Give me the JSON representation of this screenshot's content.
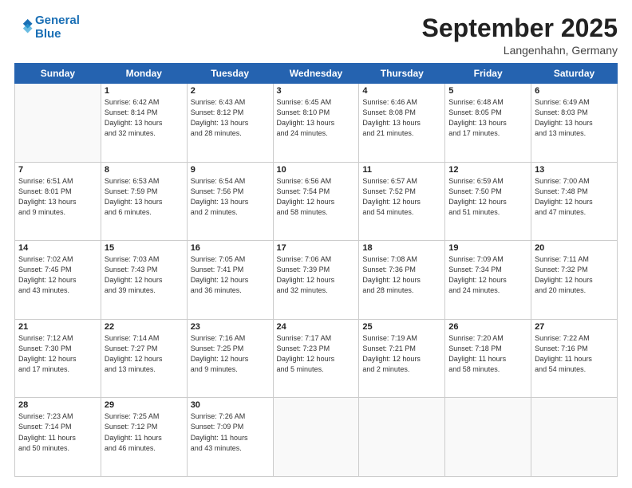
{
  "header": {
    "logo_line1": "General",
    "logo_line2": "Blue",
    "month": "September 2025",
    "location": "Langenhahn, Germany"
  },
  "weekdays": [
    "Sunday",
    "Monday",
    "Tuesday",
    "Wednesday",
    "Thursday",
    "Friday",
    "Saturday"
  ],
  "weeks": [
    [
      {
        "day": "",
        "info": ""
      },
      {
        "day": "1",
        "info": "Sunrise: 6:42 AM\nSunset: 8:14 PM\nDaylight: 13 hours\nand 32 minutes."
      },
      {
        "day": "2",
        "info": "Sunrise: 6:43 AM\nSunset: 8:12 PM\nDaylight: 13 hours\nand 28 minutes."
      },
      {
        "day": "3",
        "info": "Sunrise: 6:45 AM\nSunset: 8:10 PM\nDaylight: 13 hours\nand 24 minutes."
      },
      {
        "day": "4",
        "info": "Sunrise: 6:46 AM\nSunset: 8:08 PM\nDaylight: 13 hours\nand 21 minutes."
      },
      {
        "day": "5",
        "info": "Sunrise: 6:48 AM\nSunset: 8:05 PM\nDaylight: 13 hours\nand 17 minutes."
      },
      {
        "day": "6",
        "info": "Sunrise: 6:49 AM\nSunset: 8:03 PM\nDaylight: 13 hours\nand 13 minutes."
      }
    ],
    [
      {
        "day": "7",
        "info": "Sunrise: 6:51 AM\nSunset: 8:01 PM\nDaylight: 13 hours\nand 9 minutes."
      },
      {
        "day": "8",
        "info": "Sunrise: 6:53 AM\nSunset: 7:59 PM\nDaylight: 13 hours\nand 6 minutes."
      },
      {
        "day": "9",
        "info": "Sunrise: 6:54 AM\nSunset: 7:56 PM\nDaylight: 13 hours\nand 2 minutes."
      },
      {
        "day": "10",
        "info": "Sunrise: 6:56 AM\nSunset: 7:54 PM\nDaylight: 12 hours\nand 58 minutes."
      },
      {
        "day": "11",
        "info": "Sunrise: 6:57 AM\nSunset: 7:52 PM\nDaylight: 12 hours\nand 54 minutes."
      },
      {
        "day": "12",
        "info": "Sunrise: 6:59 AM\nSunset: 7:50 PM\nDaylight: 12 hours\nand 51 minutes."
      },
      {
        "day": "13",
        "info": "Sunrise: 7:00 AM\nSunset: 7:48 PM\nDaylight: 12 hours\nand 47 minutes."
      }
    ],
    [
      {
        "day": "14",
        "info": "Sunrise: 7:02 AM\nSunset: 7:45 PM\nDaylight: 12 hours\nand 43 minutes."
      },
      {
        "day": "15",
        "info": "Sunrise: 7:03 AM\nSunset: 7:43 PM\nDaylight: 12 hours\nand 39 minutes."
      },
      {
        "day": "16",
        "info": "Sunrise: 7:05 AM\nSunset: 7:41 PM\nDaylight: 12 hours\nand 36 minutes."
      },
      {
        "day": "17",
        "info": "Sunrise: 7:06 AM\nSunset: 7:39 PM\nDaylight: 12 hours\nand 32 minutes."
      },
      {
        "day": "18",
        "info": "Sunrise: 7:08 AM\nSunset: 7:36 PM\nDaylight: 12 hours\nand 28 minutes."
      },
      {
        "day": "19",
        "info": "Sunrise: 7:09 AM\nSunset: 7:34 PM\nDaylight: 12 hours\nand 24 minutes."
      },
      {
        "day": "20",
        "info": "Sunrise: 7:11 AM\nSunset: 7:32 PM\nDaylight: 12 hours\nand 20 minutes."
      }
    ],
    [
      {
        "day": "21",
        "info": "Sunrise: 7:12 AM\nSunset: 7:30 PM\nDaylight: 12 hours\nand 17 minutes."
      },
      {
        "day": "22",
        "info": "Sunrise: 7:14 AM\nSunset: 7:27 PM\nDaylight: 12 hours\nand 13 minutes."
      },
      {
        "day": "23",
        "info": "Sunrise: 7:16 AM\nSunset: 7:25 PM\nDaylight: 12 hours\nand 9 minutes."
      },
      {
        "day": "24",
        "info": "Sunrise: 7:17 AM\nSunset: 7:23 PM\nDaylight: 12 hours\nand 5 minutes."
      },
      {
        "day": "25",
        "info": "Sunrise: 7:19 AM\nSunset: 7:21 PM\nDaylight: 12 hours\nand 2 minutes."
      },
      {
        "day": "26",
        "info": "Sunrise: 7:20 AM\nSunset: 7:18 PM\nDaylight: 11 hours\nand 58 minutes."
      },
      {
        "day": "27",
        "info": "Sunrise: 7:22 AM\nSunset: 7:16 PM\nDaylight: 11 hours\nand 54 minutes."
      }
    ],
    [
      {
        "day": "28",
        "info": "Sunrise: 7:23 AM\nSunset: 7:14 PM\nDaylight: 11 hours\nand 50 minutes."
      },
      {
        "day": "29",
        "info": "Sunrise: 7:25 AM\nSunset: 7:12 PM\nDaylight: 11 hours\nand 46 minutes."
      },
      {
        "day": "30",
        "info": "Sunrise: 7:26 AM\nSunset: 7:09 PM\nDaylight: 11 hours\nand 43 minutes."
      },
      {
        "day": "",
        "info": ""
      },
      {
        "day": "",
        "info": ""
      },
      {
        "day": "",
        "info": ""
      },
      {
        "day": "",
        "info": ""
      }
    ]
  ]
}
